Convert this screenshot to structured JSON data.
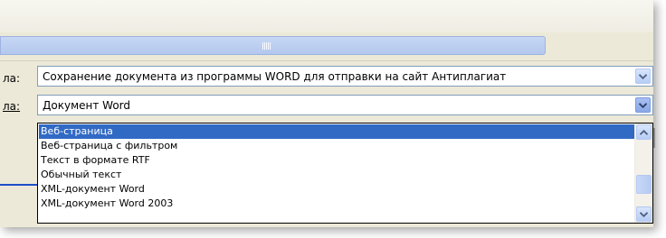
{
  "fields": {
    "file_name_label": "ла:",
    "file_name_value": "Сохранение документа из программы WORD для отправки на сайт Антиплагиат",
    "file_type_label": "ла:",
    "file_type_value": "Документ Word"
  },
  "file_type_options": [
    {
      "label": "Веб-страница",
      "selected": true
    },
    {
      "label": "Веб-страница с фильтром",
      "selected": false
    },
    {
      "label": "Текст в формате RTF",
      "selected": false
    },
    {
      "label": "Обычный текст",
      "selected": false
    },
    {
      "label": "XML-документ Word",
      "selected": false
    },
    {
      "label": "XML-документ Word 2003",
      "selected": false
    }
  ],
  "icons": {
    "dropdown": "chevron-down-icon",
    "scroll_up": "chevron-up-icon",
    "scroll_down": "chevron-down-icon"
  },
  "colors": {
    "selection": "#316ac5",
    "dialog_bg": "#ece9d8",
    "field_border": "#7f9db9"
  }
}
